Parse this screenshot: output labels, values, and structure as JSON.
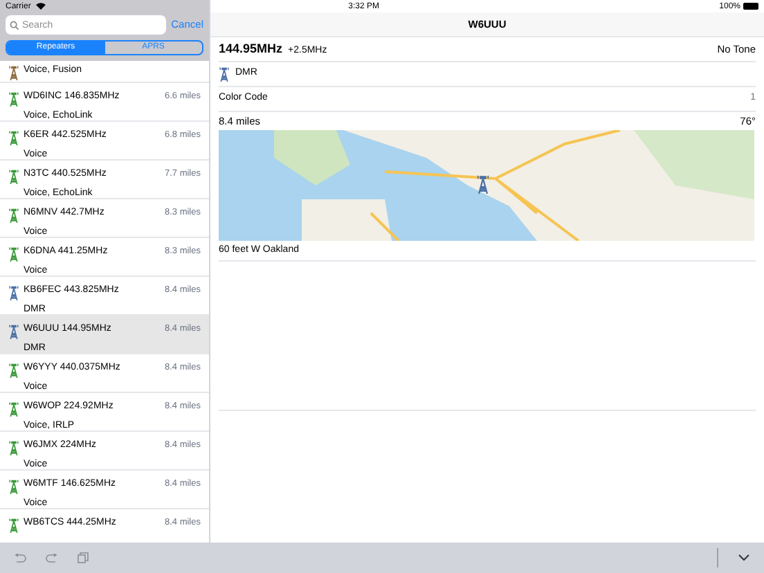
{
  "status_bar": {
    "carrier": "Carrier",
    "time": "3:32 PM",
    "battery": "100%"
  },
  "search": {
    "placeholder": "Search",
    "cancel": "Cancel"
  },
  "segments": [
    {
      "label": "Repeaters",
      "selected": true
    },
    {
      "label": "APRS",
      "selected": false
    }
  ],
  "repeaters": [
    {
      "subtitle": "Voice, Fusion",
      "color": "#8b6a3e",
      "selected": false
    },
    {
      "title": "WD6INC 146.835MHz",
      "distance": "6.6 miles",
      "subtitle": "Voice, EchoLink",
      "color": "#3a9a3a",
      "selected": false
    },
    {
      "title": "K6ER 442.525MHz",
      "distance": "6.8 miles",
      "subtitle": "Voice",
      "color": "#3a9a3a",
      "selected": false
    },
    {
      "title": "N3TC 440.525MHz",
      "distance": "7.7 miles",
      "subtitle": "Voice, EchoLink",
      "color": "#3a9a3a",
      "selected": false
    },
    {
      "title": "N6MNV 442.7MHz",
      "distance": "8.3 miles",
      "subtitle": "Voice",
      "color": "#3a9a3a",
      "selected": false
    },
    {
      "title": "K6DNA 441.25MHz",
      "distance": "8.3 miles",
      "subtitle": "Voice",
      "color": "#3a9a3a",
      "selected": false
    },
    {
      "title": "KB6FEC 443.825MHz",
      "distance": "8.4 miles",
      "subtitle": "DMR",
      "color": "#4a6fa5",
      "selected": false
    },
    {
      "title": "W6UUU 144.95MHz",
      "distance": "8.4 miles",
      "subtitle": "DMR",
      "color": "#4a6fa5",
      "selected": true
    },
    {
      "title": "W6YYY 440.0375MHz",
      "distance": "8.4 miles",
      "subtitle": "Voice",
      "color": "#3a9a3a",
      "selected": false
    },
    {
      "title": "W6WOP 224.92MHz",
      "distance": "8.4 miles",
      "subtitle": "Voice, IRLP",
      "color": "#3a9a3a",
      "selected": false
    },
    {
      "title": "W6JMX 224MHz",
      "distance": "8.4 miles",
      "subtitle": "Voice",
      "color": "#3a9a3a",
      "selected": false
    },
    {
      "title": "W6MTF 146.625MHz",
      "distance": "8.4 miles",
      "subtitle": "Voice",
      "color": "#3a9a3a",
      "selected": false
    },
    {
      "title": "WB6TCS 444.25MHz",
      "distance": "8.4 miles",
      "color": "#3a9a3a",
      "selected": false
    }
  ],
  "detail": {
    "title": "W6UUU",
    "frequency": "144.95MHz",
    "offset": "+2.5MHz",
    "tone": "No Tone",
    "mode": {
      "label": "DMR",
      "color": "#4a6fa5"
    },
    "color_code_label": "Color Code",
    "color_code": "1",
    "distance": "8.4 miles",
    "bearing": "76°",
    "location": "60 feet W Oakland"
  }
}
